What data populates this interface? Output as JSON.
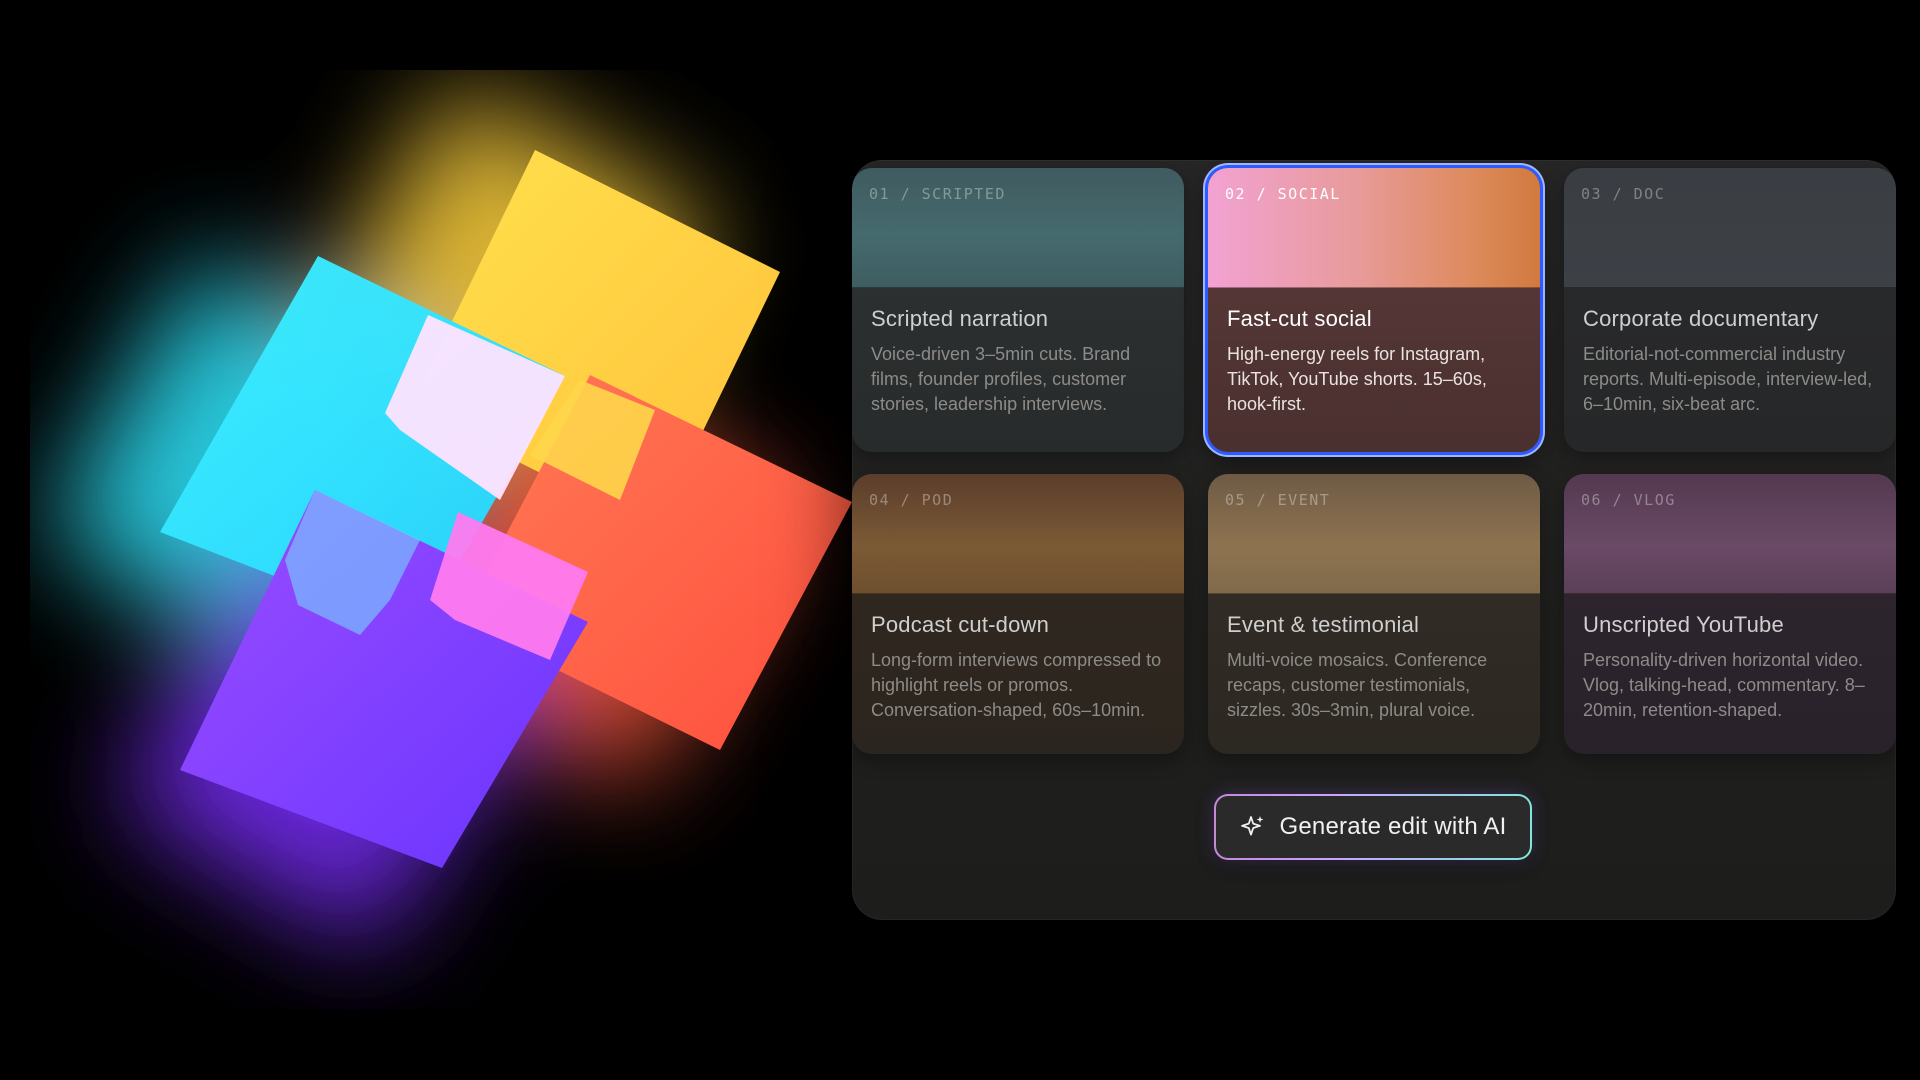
{
  "templates": [
    {
      "tag": "01 / SCRIPTED",
      "title": "Scripted narration",
      "description": "Voice-driven 3–5min cuts. Brand films, founder profiles, customer stories, leadership interviews.",
      "selected": false
    },
    {
      "tag": "02 / SOCIAL",
      "title": "Fast-cut social",
      "description": "High-energy reels for Instagram, TikTok, YouTube shorts. 15–60s, hook-first.",
      "selected": true
    },
    {
      "tag": "03 / DOC",
      "title": "Corporate documentary",
      "description": "Editorial-not-commercial industry reports. Multi-episode, interview-led, 6–10min, six-beat arc.",
      "selected": false
    },
    {
      "tag": "04 / POD",
      "title": "Podcast cut-down",
      "description": "Long-form interviews compressed to highlight reels or promos. Conversation-shaped, 60s–10min.",
      "selected": false
    },
    {
      "tag": "05 / EVENT",
      "title": "Event & testimonial",
      "description": "Multi-voice mosaics. Conference recaps, customer testimonials, sizzles. 30s–3min, plural voice.",
      "selected": false
    },
    {
      "tag": "06 / VLOG",
      "title": "Unscripted YouTube",
      "description": "Personality-driven horizontal video. Vlog, talking-head, commentary. 8–20min, retention-shaped.",
      "selected": false
    }
  ],
  "action": {
    "label": "Generate edit with AI",
    "icon": "sparkle-icon"
  },
  "colors": {
    "selected_border": "#2d5bff",
    "logo_cyan": "#2fe3ff",
    "logo_yellow": "#ffd84a",
    "logo_orange": "#ff6a4a",
    "logo_purple": "#7a3cff",
    "logo_pink": "#ff7ff0"
  }
}
